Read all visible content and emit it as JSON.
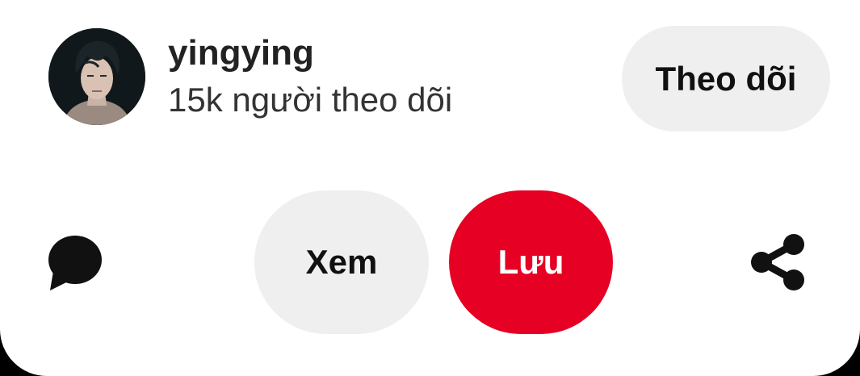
{
  "profile": {
    "username": "yingying",
    "followers_text": "15k người theo dõi",
    "avatar_icon": "user-avatar"
  },
  "actions": {
    "follow_label": "Theo dõi",
    "view_label": "Xem",
    "save_label": "Lưu",
    "comment_icon": "comment-icon",
    "share_icon": "share-icon"
  },
  "colors": {
    "save_bg": "#e60023",
    "button_bg": "#efefef",
    "text": "#111111"
  }
}
